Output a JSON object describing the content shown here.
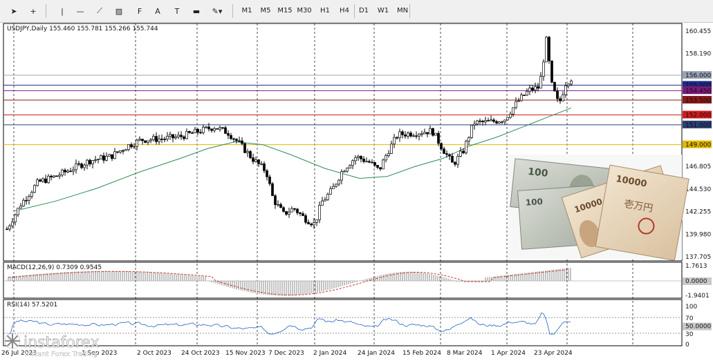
{
  "toolbar": {
    "tools": [
      {
        "name": "cursor-icon",
        "glyph": "➤"
      },
      {
        "name": "crosshair-icon",
        "glyph": "+"
      },
      {
        "name": "vertical-line-icon",
        "glyph": "|"
      },
      {
        "name": "horizontal-line-icon",
        "glyph": "—"
      },
      {
        "name": "trendline-icon",
        "glyph": "⟋"
      },
      {
        "name": "channel-icon",
        "glyph": "▨"
      },
      {
        "name": "fibonacci-icon",
        "glyph": "F"
      },
      {
        "name": "text-icon",
        "glyph": "A"
      },
      {
        "name": "text-label-icon",
        "glyph": "T"
      },
      {
        "name": "rectangle-icon",
        "glyph": "▬"
      },
      {
        "name": "shapes-dropdown-icon",
        "glyph": "✎▾"
      }
    ],
    "timeframes": [
      "M1",
      "M5",
      "M15",
      "M30",
      "H1",
      "H4",
      "D1",
      "W1",
      "MN"
    ]
  },
  "chart": {
    "header": "USDJPY,Daily  155.460 155.781 155.266 155.744",
    "price_labels": [
      "160.455",
      "158.190",
      "155.925",
      "153.500",
      "151.000",
      "149.000",
      "146.805",
      "144.530",
      "142.255",
      "139.980",
      "137.705"
    ],
    "level_labels": [
      {
        "text": "156.000",
        "color": "#9aa3b5",
        "textcolor": "#ffffff"
      },
      {
        "text": "155.000",
        "color": "#1f2a8c",
        "textcolor": "#ffffff"
      },
      {
        "text": "154.450",
        "color": "#7b1a7b",
        "textcolor": "#ffffff"
      },
      {
        "text": "153.500",
        "color": "#8b1a1a",
        "textcolor": "#ffffff"
      },
      {
        "text": "152.000",
        "color": "#d01c1c",
        "textcolor": "#ffffff"
      },
      {
        "text": "151.000",
        "color": "#2b3f73",
        "textcolor": "#ffffff"
      },
      {
        "text": "149.000",
        "color": "#e0b800",
        "textcolor": "#111111"
      }
    ],
    "date_labels": [
      "26 Jul 2023",
      "1 Sep 2023",
      "2 Oct 2023",
      "24 Oct 2023",
      "15 Nov 2023",
      "7 Dec 2023",
      "2 Jan 2024",
      "24 Jan 2024",
      "15 Feb 2024",
      "8 Mar 2024",
      "1 Apr 2024",
      "23 Apr 2024"
    ],
    "macd": {
      "label": "MACD(12,26,9) 0.7309 0.9545",
      "levels": [
        "1.7613",
        "0.0000",
        "-1.9401"
      ]
    },
    "rsi": {
      "label": "RSI(14) 57.5201",
      "levels": [
        "100",
        "70",
        "50.0000",
        "30",
        "0"
      ]
    },
    "colors": {
      "up": "#ffffff",
      "down": "#000000",
      "ma": "#2e8b57",
      "macd_signal": "#c0392b",
      "grid": "#000000"
    }
  },
  "logo": {
    "brand": "instaforex",
    "tagline": "Instant Forex Trading"
  }
}
